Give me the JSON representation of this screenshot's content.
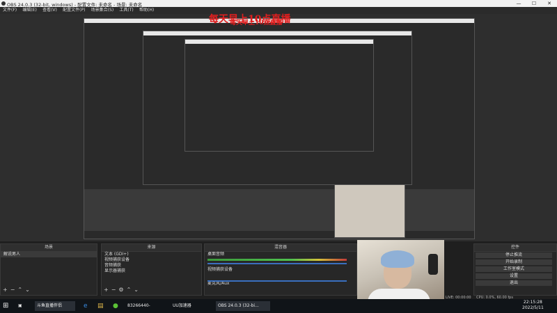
{
  "titlebar": {
    "title": "OBS 24.0.3 (32-bit, windows) - 配置文件: 未命名 - 场景: 未命名",
    "minimize": "—",
    "maximize": "☐",
    "close": "✕"
  },
  "menu": [
    "文件(F)",
    "编辑(E)",
    "查看(V)",
    "配置文件(P)",
    "场景集合(S)",
    "工具(T)",
    "帮助(H)"
  ],
  "overlay_text": "每天早上10点直播",
  "panels": {
    "scenes": {
      "title": "场景",
      "items": [
        "解说男人"
      ]
    },
    "sources": {
      "title": "来源",
      "items": [
        "文本 (GDI+)",
        "视频捕获设备",
        "音频捕获",
        "显示器捕获"
      ]
    },
    "mixer": {
      "title": "混音器",
      "tracks": [
        "桌面音频",
        "视频捕获设备",
        "麦克风/Aux"
      ]
    },
    "controls": {
      "title": "控件",
      "buttons": [
        "停止推流",
        "开始录制",
        "工作室模式",
        "设置",
        "退出"
      ]
    }
  },
  "status": {
    "cpu": "CPU: 0.0%, 60.00 fps",
    "live": "LIVE: 00:00:00"
  },
  "taskbar": {
    "items": [
      "斗鱼直播伴侣",
      "83266440-",
      "UU加速器",
      "OBS 24.0.3 (32-bi..."
    ],
    "time": "22:15:28",
    "date": "2022/5/11"
  }
}
